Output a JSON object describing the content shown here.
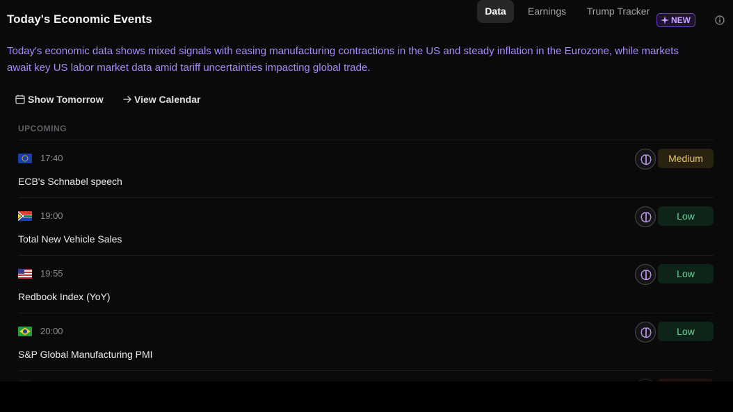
{
  "header": {
    "title": "Today's Economic Events",
    "tabs": [
      {
        "label": "Data",
        "active": true
      },
      {
        "label": "Earnings",
        "active": false
      },
      {
        "label": "Trump Tracker",
        "active": false
      }
    ],
    "new_badge": "NEW",
    "info_icon": "info-icon"
  },
  "summary": "Today's economic data shows mixed signals with easing manufacturing contractions in the US and steady inflation in the Eurozone, while markets await key US labor market data amid tariff uncertainties impacting global trade.",
  "actions": {
    "show_tomorrow": "Show Tomorrow",
    "view_calendar": "View Calendar"
  },
  "section_label": "UPCOMING",
  "events": [
    {
      "flag": "EU",
      "time": "17:40",
      "name": "ECB's Schnabel speech",
      "impact": "Medium"
    },
    {
      "flag": "ZA",
      "time": "19:00",
      "name": "Total New Vehicle Sales",
      "impact": "Low"
    },
    {
      "flag": "US",
      "time": "19:55",
      "name": "Redbook Index (YoY)",
      "impact": "Low"
    },
    {
      "flag": "BR",
      "time": "20:00",
      "name": "S&P Global Manufacturing PMI",
      "impact": "Low"
    }
  ],
  "colors": {
    "accent_purple": "#a78bfa",
    "impact_medium": "#e9c46a",
    "impact_low": "#6ad39a",
    "impact_high": "#5a1e1e"
  }
}
